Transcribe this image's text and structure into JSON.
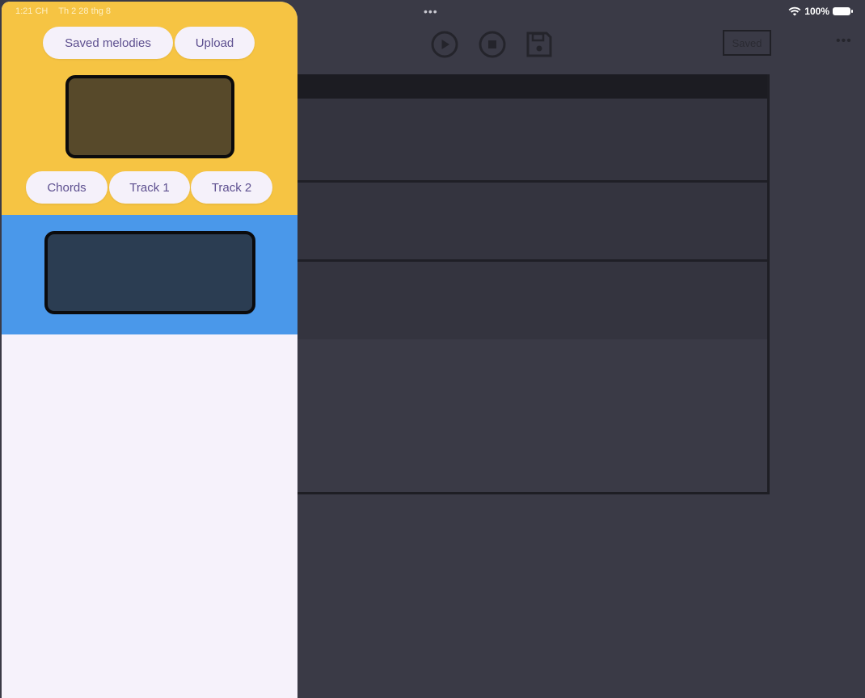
{
  "status_bar": {
    "time": "1:21 CH",
    "date": "Th 2 28 thg 8",
    "battery": "100%"
  },
  "toolbar": {
    "saved_label": "Saved",
    "play_icon": "play-icon",
    "stop_icon": "stop-icon",
    "save_icon": "floppy-disk-icon",
    "more_icon": "more-icon"
  },
  "panel": {
    "top_buttons": [
      "Saved melodies",
      "Upload"
    ],
    "track_buttons": [
      "Chords",
      "Track 1",
      "Track 2"
    ]
  },
  "colors": {
    "background": "#3a3a46",
    "panel_yellow": "#f6c443",
    "panel_blue": "#4a98ea",
    "panel_white": "#f6f2fb",
    "pill_text": "#5d4f8f"
  }
}
